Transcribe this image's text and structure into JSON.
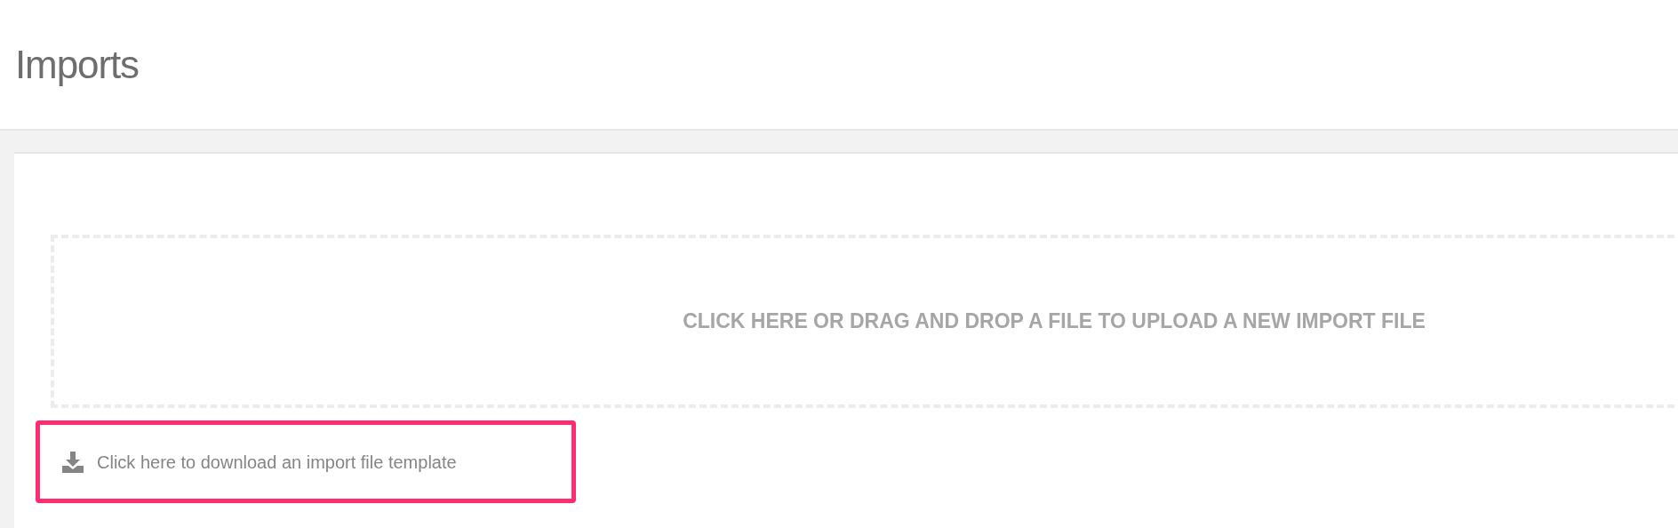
{
  "page": {
    "title": "Imports"
  },
  "dropzone": {
    "label": "CLICK HERE OR DRAG AND DROP A FILE TO UPLOAD A NEW IMPORT FILE"
  },
  "template_link": {
    "label": "Click here to download an import file template",
    "highlighted": true
  }
}
